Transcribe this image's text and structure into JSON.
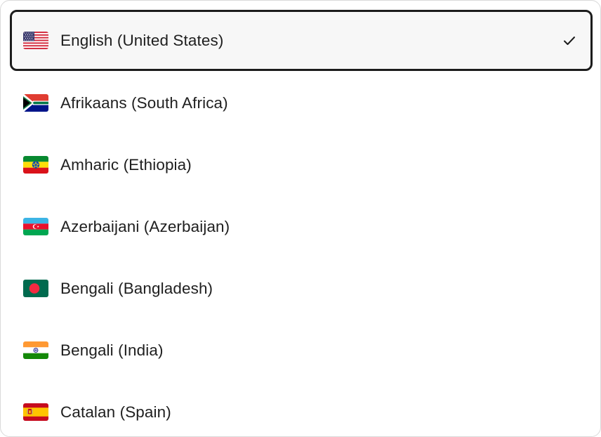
{
  "languages": [
    {
      "label": "English (United States)",
      "flag": "flag-us-icon",
      "selected": true
    },
    {
      "label": "Afrikaans (South Africa)",
      "flag": "flag-za-icon",
      "selected": false
    },
    {
      "label": "Amharic (Ethiopia)",
      "flag": "flag-et-icon",
      "selected": false
    },
    {
      "label": "Azerbaijani (Azerbaijan)",
      "flag": "flag-az-icon",
      "selected": false
    },
    {
      "label": "Bengali (Bangladesh)",
      "flag": "flag-bd-icon",
      "selected": false
    },
    {
      "label": "Bengali (India)",
      "flag": "flag-in-icon",
      "selected": false
    },
    {
      "label": "Catalan (Spain)",
      "flag": "flag-es-ct-icon",
      "selected": false
    }
  ],
  "check_icon": "checkmark-icon",
  "colors": {
    "selected_border": "#1c1c1c",
    "selected_bg": "#f7f7f7",
    "text": "#1f1f1f"
  }
}
